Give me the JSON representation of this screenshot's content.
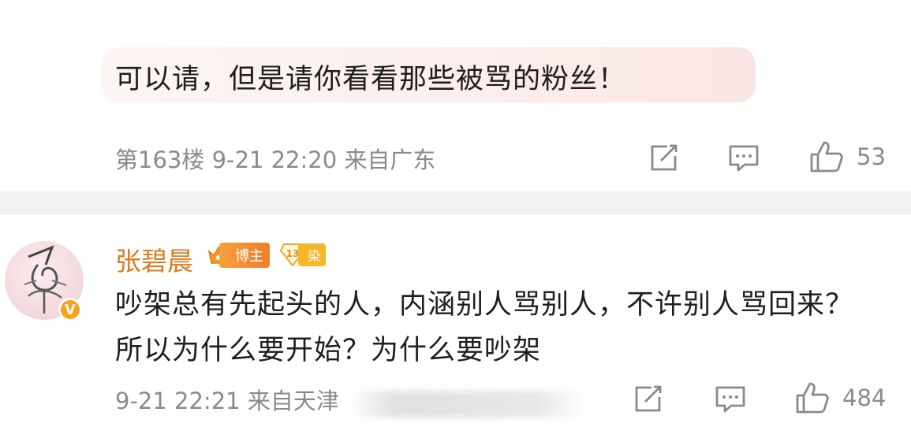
{
  "comment1": {
    "quote": "可以请，但是请你看看那些被骂的粉丝！",
    "meta": "第163楼 9-21 22:20 来自广东",
    "likes": "53",
    "icons": [
      "share-icon",
      "comment-icon",
      "like-icon"
    ]
  },
  "comment2": {
    "username": "张碧晨",
    "badge_blogger": "博主",
    "badge_fan_level": "13",
    "badge_fan_label": "染",
    "text": "吵架总有先起头的人，内涵别人骂别人，不许别人骂回来？所以为什么要开始？为什么要吵架",
    "meta": "9-21 22:21 来自天津",
    "likes": "484",
    "verified": "V",
    "icons": [
      "avatar",
      "verified-icon",
      "share-icon",
      "comment-icon",
      "like-icon"
    ]
  },
  "colors": {
    "username": "#e07a1f",
    "meta": "#8a8a8a",
    "divider": "#f2f2f2",
    "verified": "#f8a21b"
  }
}
